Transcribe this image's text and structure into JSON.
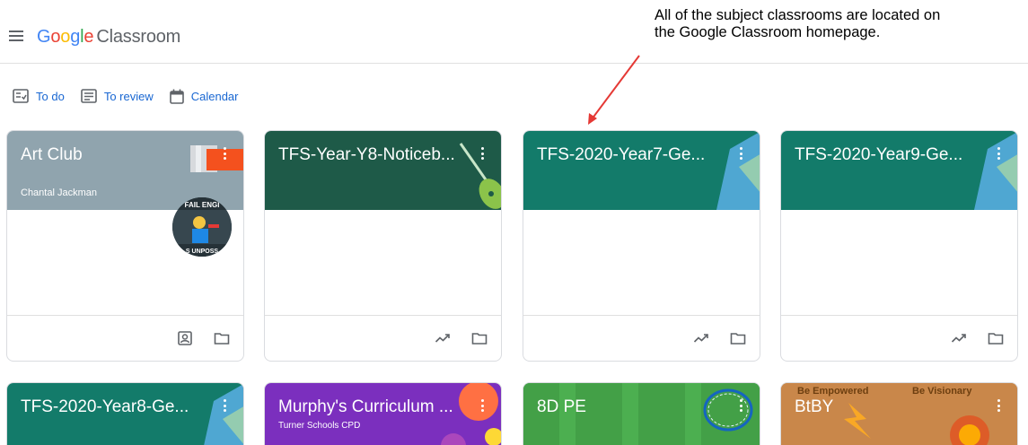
{
  "header": {
    "logo_parts": [
      "G",
      "o",
      "o",
      "g",
      "l",
      "e"
    ],
    "product": "Classroom"
  },
  "annotation": {
    "text": "All of the subject classrooms are located on the Google Classroom homepage."
  },
  "subnav": {
    "todo": "To do",
    "review": "To review",
    "calendar": "Calendar"
  },
  "cards": [
    {
      "title": "Art Club",
      "subtitle": "Chantal Jackman",
      "color": "#90a4ae"
    },
    {
      "title": "TFS-Year-Y8-Noticeb...",
      "color": "#1e5a48"
    },
    {
      "title": "TFS-2020-Year7-Ge...",
      "color": "#137b6a"
    },
    {
      "title": "TFS-2020-Year9-Ge...",
      "color": "#137b6a"
    },
    {
      "title": "TFS-2020-Year8-Ge...",
      "color": "#137b6a"
    },
    {
      "title": "Murphy's Curriculum ...",
      "subtitle": "Turner Schools CPD",
      "color": "#7b2fbe"
    },
    {
      "title": "8D PE",
      "color": "#34a853"
    },
    {
      "title": "BtBY",
      "color": "#c9874a",
      "banner_text_1": "Be Empowered",
      "banner_text_2": "Be Visionary"
    }
  ],
  "art_avatar_text": {
    "top": "FAIL ENGI",
    "bottom": "S UNPOSS"
  }
}
